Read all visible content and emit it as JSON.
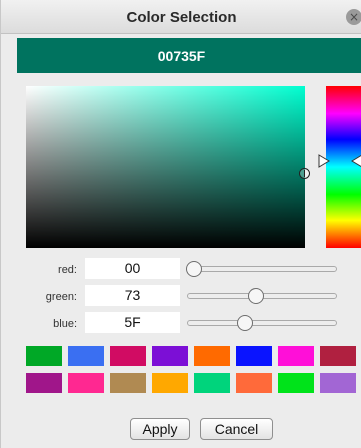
{
  "window": {
    "title": "Color Selection"
  },
  "color": {
    "hex": "00735F"
  },
  "channels": [
    {
      "label": "red:",
      "value": "00",
      "level": 0.0
    },
    {
      "label": "green:",
      "value": "73",
      "level": 0.45
    },
    {
      "label": "blue:",
      "value": "5F",
      "level": 0.37
    }
  ],
  "swatches": [
    "#00a826",
    "#3a6ff2",
    "#d10c63",
    "#7c0fd6",
    "#ff6a00",
    "#0a14ff",
    "#ff0fd8",
    "#b02040",
    "#a0168a",
    "#ff2891",
    "#b08a52",
    "#ffa800",
    "#00d47c",
    "#ff6a3a",
    "#00e31a",
    "#a266d4"
  ],
  "buttons": {
    "apply": "Apply",
    "cancel": "Cancel"
  },
  "icons": {
    "close": "close-icon"
  }
}
